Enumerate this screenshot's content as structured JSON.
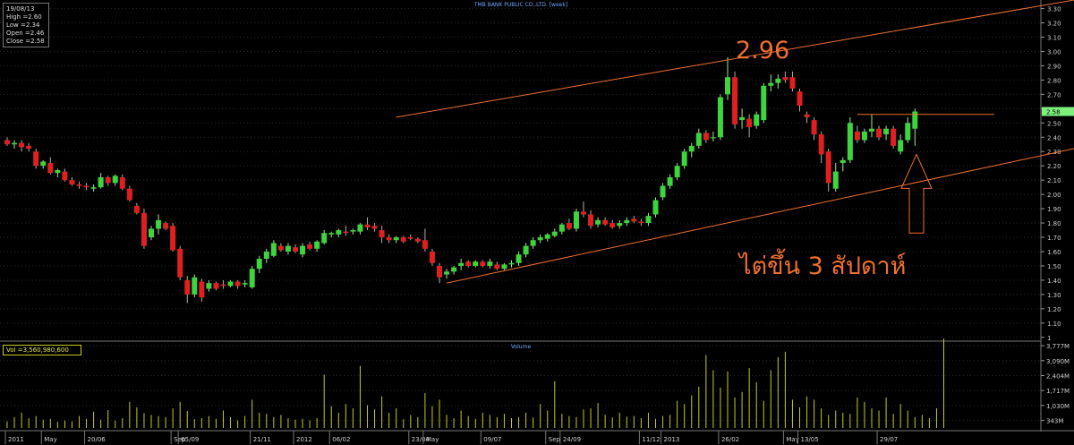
{
  "info": {
    "date": "19/08/13",
    "high": "High  =2.60",
    "low": "Low   =2.34",
    "open": "Open  =2.46",
    "close": "Close =2.58"
  },
  "volume_box": "Vol   =3,560,980,600",
  "colors": {
    "up": "#3dd43d",
    "down": "#e02020",
    "trend": "#f07030",
    "volume": "#c8c820",
    "grid": "#2a2a2a",
    "price_tag": "#7ef07e"
  },
  "chart_data": [
    {
      "type": "candlestick",
      "title": "TMB BANK PUBLIC CO.,LTD. [week]",
      "ylim": [
        0.98,
        3.36
      ],
      "y_ticks": [
        "3.30",
        "3.20",
        "3.10",
        "3.00",
        "2.90",
        "2.80",
        "2.70",
        "2.60",
        "2.50",
        "2.40",
        "2.30",
        "2.20",
        "2.10",
        "2.00",
        "1.90",
        "1.80",
        "1.70",
        "1.60",
        "1.50",
        "1.40",
        "1.30",
        "1.20",
        "1.10",
        "1"
      ],
      "last_price_tag": "2.58",
      "annotations": [
        "2.96",
        "ไต่ขึ้น 3 สัปดาห์"
      ],
      "candles": [
        {
          "o": 2.38,
          "h": 2.4,
          "l": 2.34,
          "c": 2.35
        },
        {
          "o": 2.35,
          "h": 2.38,
          "l": 2.32,
          "c": 2.36
        },
        {
          "o": 2.36,
          "h": 2.38,
          "l": 2.3,
          "c": 2.33
        },
        {
          "o": 2.34,
          "h": 2.36,
          "l": 2.3,
          "c": 2.32
        },
        {
          "o": 2.3,
          "h": 2.32,
          "l": 2.18,
          "c": 2.2
        },
        {
          "o": 2.2,
          "h": 2.24,
          "l": 2.18,
          "c": 2.23
        },
        {
          "o": 2.22,
          "h": 2.26,
          "l": 2.14,
          "c": 2.15
        },
        {
          "o": 2.15,
          "h": 2.18,
          "l": 2.12,
          "c": 2.17
        },
        {
          "o": 2.16,
          "h": 2.18,
          "l": 2.09,
          "c": 2.1
        },
        {
          "o": 2.1,
          "h": 2.12,
          "l": 2.06,
          "c": 2.07
        },
        {
          "o": 2.07,
          "h": 2.09,
          "l": 2.04,
          "c": 2.06
        },
        {
          "o": 2.06,
          "h": 2.08,
          "l": 2.03,
          "c": 2.05
        },
        {
          "o": 2.04,
          "h": 2.07,
          "l": 2.02,
          "c": 2.05
        },
        {
          "o": 2.05,
          "h": 2.15,
          "l": 2.04,
          "c": 2.12
        },
        {
          "o": 2.12,
          "h": 2.13,
          "l": 2.06,
          "c": 2.08
        },
        {
          "o": 2.08,
          "h": 2.14,
          "l": 2.06,
          "c": 2.13
        },
        {
          "o": 2.12,
          "h": 2.14,
          "l": 2.03,
          "c": 2.04
        },
        {
          "o": 2.04,
          "h": 2.06,
          "l": 1.95,
          "c": 1.96
        },
        {
          "o": 1.92,
          "h": 1.94,
          "l": 1.86,
          "c": 1.87
        },
        {
          "o": 1.87,
          "h": 1.9,
          "l": 1.62,
          "c": 1.64
        },
        {
          "o": 1.7,
          "h": 1.78,
          "l": 1.68,
          "c": 1.76
        },
        {
          "o": 1.76,
          "h": 1.86,
          "l": 1.72,
          "c": 1.82
        },
        {
          "o": 1.8,
          "h": 1.81,
          "l": 1.75,
          "c": 1.76
        },
        {
          "o": 1.78,
          "h": 1.8,
          "l": 1.6,
          "c": 1.61
        },
        {
          "o": 1.62,
          "h": 1.64,
          "l": 1.4,
          "c": 1.42
        },
        {
          "o": 1.4,
          "h": 1.43,
          "l": 1.24,
          "c": 1.3
        },
        {
          "o": 1.3,
          "h": 1.44,
          "l": 1.28,
          "c": 1.42
        },
        {
          "o": 1.39,
          "h": 1.41,
          "l": 1.25,
          "c": 1.28
        },
        {
          "o": 1.34,
          "h": 1.4,
          "l": 1.32,
          "c": 1.38
        },
        {
          "o": 1.38,
          "h": 1.39,
          "l": 1.33,
          "c": 1.34
        },
        {
          "o": 1.37,
          "h": 1.4,
          "l": 1.34,
          "c": 1.36
        },
        {
          "o": 1.36,
          "h": 1.4,
          "l": 1.35,
          "c": 1.39
        },
        {
          "o": 1.39,
          "h": 1.4,
          "l": 1.34,
          "c": 1.36
        },
        {
          "o": 1.37,
          "h": 1.4,
          "l": 1.35,
          "c": 1.38
        },
        {
          "o": 1.35,
          "h": 1.5,
          "l": 1.34,
          "c": 1.48
        },
        {
          "o": 1.48,
          "h": 1.57,
          "l": 1.45,
          "c": 1.55
        },
        {
          "o": 1.55,
          "h": 1.62,
          "l": 1.52,
          "c": 1.6
        },
        {
          "o": 1.57,
          "h": 1.68,
          "l": 1.56,
          "c": 1.66
        },
        {
          "o": 1.64,
          "h": 1.66,
          "l": 1.6,
          "c": 1.61
        },
        {
          "o": 1.6,
          "h": 1.66,
          "l": 1.58,
          "c": 1.64
        },
        {
          "o": 1.63,
          "h": 1.65,
          "l": 1.59,
          "c": 1.6
        },
        {
          "o": 1.58,
          "h": 1.66,
          "l": 1.56,
          "c": 1.64
        },
        {
          "o": 1.65,
          "h": 1.67,
          "l": 1.61,
          "c": 1.62
        },
        {
          "o": 1.62,
          "h": 1.68,
          "l": 1.6,
          "c": 1.67
        },
        {
          "o": 1.66,
          "h": 1.75,
          "l": 1.65,
          "c": 1.73
        },
        {
          "o": 1.72,
          "h": 1.74,
          "l": 1.7,
          "c": 1.73
        },
        {
          "o": 1.72,
          "h": 1.76,
          "l": 1.7,
          "c": 1.75
        },
        {
          "o": 1.74,
          "h": 1.78,
          "l": 1.71,
          "c": 1.73
        },
        {
          "o": 1.74,
          "h": 1.76,
          "l": 1.72,
          "c": 1.75
        },
        {
          "o": 1.74,
          "h": 1.8,
          "l": 1.72,
          "c": 1.79
        },
        {
          "o": 1.79,
          "h": 1.84,
          "l": 1.75,
          "c": 1.77
        },
        {
          "o": 1.78,
          "h": 1.8,
          "l": 1.74,
          "c": 1.76
        },
        {
          "o": 1.75,
          "h": 1.78,
          "l": 1.66,
          "c": 1.7
        },
        {
          "o": 1.7,
          "h": 1.72,
          "l": 1.66,
          "c": 1.68
        },
        {
          "o": 1.68,
          "h": 1.71,
          "l": 1.66,
          "c": 1.7
        },
        {
          "o": 1.7,
          "h": 1.71,
          "l": 1.66,
          "c": 1.67
        },
        {
          "o": 1.7,
          "h": 1.72,
          "l": 1.68,
          "c": 1.69
        },
        {
          "o": 1.69,
          "h": 1.7,
          "l": 1.66,
          "c": 1.67
        },
        {
          "o": 1.68,
          "h": 1.76,
          "l": 1.6,
          "c": 1.62
        },
        {
          "o": 1.6,
          "h": 1.62,
          "l": 1.5,
          "c": 1.52
        },
        {
          "o": 1.5,
          "h": 1.52,
          "l": 1.38,
          "c": 1.42
        },
        {
          "o": 1.44,
          "h": 1.48,
          "l": 1.41,
          "c": 1.46
        },
        {
          "o": 1.46,
          "h": 1.5,
          "l": 1.44,
          "c": 1.49
        },
        {
          "o": 1.5,
          "h": 1.55,
          "l": 1.47,
          "c": 1.52
        },
        {
          "o": 1.53,
          "h": 1.54,
          "l": 1.49,
          "c": 1.5
        },
        {
          "o": 1.5,
          "h": 1.54,
          "l": 1.49,
          "c": 1.53
        },
        {
          "o": 1.53,
          "h": 1.54,
          "l": 1.49,
          "c": 1.5
        },
        {
          "o": 1.5,
          "h": 1.55,
          "l": 1.48,
          "c": 1.53
        },
        {
          "o": 1.51,
          "h": 1.53,
          "l": 1.47,
          "c": 1.48
        },
        {
          "o": 1.48,
          "h": 1.52,
          "l": 1.47,
          "c": 1.51
        },
        {
          "o": 1.51,
          "h": 1.54,
          "l": 1.49,
          "c": 1.52
        },
        {
          "o": 1.52,
          "h": 1.6,
          "l": 1.5,
          "c": 1.58
        },
        {
          "o": 1.58,
          "h": 1.66,
          "l": 1.56,
          "c": 1.64
        },
        {
          "o": 1.64,
          "h": 1.7,
          "l": 1.62,
          "c": 1.68
        },
        {
          "o": 1.68,
          "h": 1.72,
          "l": 1.66,
          "c": 1.7
        },
        {
          "o": 1.69,
          "h": 1.73,
          "l": 1.67,
          "c": 1.72
        },
        {
          "o": 1.71,
          "h": 1.76,
          "l": 1.7,
          "c": 1.74
        },
        {
          "o": 1.74,
          "h": 1.8,
          "l": 1.72,
          "c": 1.79
        },
        {
          "o": 1.8,
          "h": 1.83,
          "l": 1.75,
          "c": 1.76
        },
        {
          "o": 1.76,
          "h": 1.9,
          "l": 1.74,
          "c": 1.88
        },
        {
          "o": 1.88,
          "h": 1.95,
          "l": 1.84,
          "c": 1.86
        },
        {
          "o": 1.86,
          "h": 1.89,
          "l": 1.76,
          "c": 1.78
        },
        {
          "o": 1.79,
          "h": 1.84,
          "l": 1.77,
          "c": 1.82
        },
        {
          "o": 1.82,
          "h": 1.84,
          "l": 1.78,
          "c": 1.79
        },
        {
          "o": 1.8,
          "h": 1.82,
          "l": 1.76,
          "c": 1.77
        },
        {
          "o": 1.78,
          "h": 1.82,
          "l": 1.76,
          "c": 1.8
        },
        {
          "o": 1.8,
          "h": 1.84,
          "l": 1.78,
          "c": 1.82
        },
        {
          "o": 1.83,
          "h": 1.85,
          "l": 1.8,
          "c": 1.81
        },
        {
          "o": 1.81,
          "h": 1.83,
          "l": 1.78,
          "c": 1.8
        },
        {
          "o": 1.8,
          "h": 1.87,
          "l": 1.78,
          "c": 1.85
        },
        {
          "o": 1.86,
          "h": 1.98,
          "l": 1.84,
          "c": 1.96
        },
        {
          "o": 1.98,
          "h": 2.08,
          "l": 1.96,
          "c": 2.06
        },
        {
          "o": 2.06,
          "h": 2.14,
          "l": 2.04,
          "c": 2.12
        },
        {
          "o": 2.12,
          "h": 2.22,
          "l": 2.1,
          "c": 2.2
        },
        {
          "o": 2.2,
          "h": 2.32,
          "l": 2.18,
          "c": 2.3
        },
        {
          "o": 2.3,
          "h": 2.36,
          "l": 2.26,
          "c": 2.34
        },
        {
          "o": 2.34,
          "h": 2.46,
          "l": 2.32,
          "c": 2.43
        },
        {
          "o": 2.43,
          "h": 2.45,
          "l": 2.36,
          "c": 2.38
        },
        {
          "o": 2.4,
          "h": 2.44,
          "l": 2.37,
          "c": 2.4
        },
        {
          "o": 2.4,
          "h": 2.7,
          "l": 2.38,
          "c": 2.68
        },
        {
          "o": 2.7,
          "h": 2.96,
          "l": 2.66,
          "c": 2.82
        },
        {
          "o": 2.82,
          "h": 2.86,
          "l": 2.46,
          "c": 2.49
        },
        {
          "o": 2.52,
          "h": 2.6,
          "l": 2.46,
          "c": 2.54
        },
        {
          "o": 2.53,
          "h": 2.56,
          "l": 2.4,
          "c": 2.47
        },
        {
          "o": 2.48,
          "h": 2.58,
          "l": 2.46,
          "c": 2.56
        },
        {
          "o": 2.52,
          "h": 2.78,
          "l": 2.5,
          "c": 2.76
        },
        {
          "o": 2.76,
          "h": 2.84,
          "l": 2.72,
          "c": 2.78
        },
        {
          "o": 2.78,
          "h": 2.84,
          "l": 2.74,
          "c": 2.81
        },
        {
          "o": 2.82,
          "h": 2.86,
          "l": 2.78,
          "c": 2.8
        },
        {
          "o": 2.82,
          "h": 2.86,
          "l": 2.72,
          "c": 2.74
        },
        {
          "o": 2.72,
          "h": 2.74,
          "l": 2.58,
          "c": 2.62
        },
        {
          "o": 2.56,
          "h": 2.58,
          "l": 2.5,
          "c": 2.54
        },
        {
          "o": 2.52,
          "h": 2.54,
          "l": 2.38,
          "c": 2.42
        },
        {
          "o": 2.42,
          "h": 2.44,
          "l": 2.22,
          "c": 2.28
        },
        {
          "o": 2.3,
          "h": 2.32,
          "l": 2.02,
          "c": 2.08
        },
        {
          "o": 2.04,
          "h": 2.22,
          "l": 2.02,
          "c": 2.16
        },
        {
          "o": 2.22,
          "h": 2.26,
          "l": 2.16,
          "c": 2.24
        },
        {
          "o": 2.24,
          "h": 2.54,
          "l": 2.22,
          "c": 2.5
        },
        {
          "o": 2.44,
          "h": 2.48,
          "l": 2.36,
          "c": 2.38
        },
        {
          "o": 2.38,
          "h": 2.46,
          "l": 2.36,
          "c": 2.44
        },
        {
          "o": 2.44,
          "h": 2.56,
          "l": 2.4,
          "c": 2.46
        },
        {
          "o": 2.46,
          "h": 2.48,
          "l": 2.38,
          "c": 2.4
        },
        {
          "o": 2.42,
          "h": 2.48,
          "l": 2.38,
          "c": 2.46
        },
        {
          "o": 2.46,
          "h": 2.48,
          "l": 2.32,
          "c": 2.34
        },
        {
          "o": 2.3,
          "h": 2.42,
          "l": 2.28,
          "c": 2.38
        },
        {
          "o": 2.38,
          "h": 2.54,
          "l": 2.36,
          "c": 2.5
        },
        {
          "o": 2.46,
          "h": 2.6,
          "l": 2.34,
          "c": 2.58
        }
      ]
    },
    {
      "type": "bar",
      "title": "Volume",
      "ylim": [
        0,
        3944000000
      ],
      "y_ticks": [
        "3,777M",
        "3,090M",
        "2,404M",
        "1,717M",
        "1,030M",
        "343M"
      ],
      "values": [
        300000000,
        500000000,
        700000000,
        450000000,
        550000000,
        380000000,
        420000000,
        280000000,
        350000000,
        300000000,
        550000000,
        420000000,
        750000000,
        380000000,
        820000000,
        350000000,
        450000000,
        1200000000,
        950000000,
        680000000,
        600000000,
        550000000,
        500000000,
        900000000,
        1200000000,
        780000000,
        400000000,
        450000000,
        550000000,
        420000000,
        800000000,
        500000000,
        350000000,
        550000000,
        1300000000,
        700000000,
        650000000,
        500000000,
        600000000,
        450000000,
        380000000,
        420000000,
        350000000,
        450000000,
        2450000000,
        1000000000,
        700000000,
        1100000000,
        900000000,
        2850000000,
        1050000000,
        850000000,
        1450000000,
        700000000,
        900000000,
        400000000,
        600000000,
        500000000,
        1600000000,
        1000000000,
        1300000000,
        600000000,
        450000000,
        800000000,
        550000000,
        420000000,
        700000000,
        600000000,
        500000000,
        650000000,
        450000000,
        500000000,
        700000000,
        480000000,
        1100000000,
        800000000,
        2150000000,
        650000000,
        550000000,
        500000000,
        850000000,
        900000000,
        1150000000,
        600000000,
        480000000,
        700000000,
        520000000,
        550000000,
        450000000,
        700000000,
        420000000,
        550000000,
        600000000,
        1250000000,
        1100000000,
        1500000000,
        1900000000,
        3350000000,
        2650000000,
        1850000000,
        2600000000,
        1400000000,
        1650000000,
        2750000000,
        2100000000,
        1250000000,
        2650000000,
        3250000000,
        3500000000,
        1300000000,
        950000000,
        1450000000,
        1300000000,
        900000000,
        600000000,
        800000000,
        700000000,
        650000000,
        1400000000,
        1200000000,
        900000000,
        800000000,
        1400000000,
        650000000,
        1100000000,
        800000000,
        500000000,
        600000000,
        450000000,
        900000000,
        4100000000
      ]
    }
  ],
  "x_labels": [
    {
      "text": "2011",
      "i": 0
    },
    {
      "text": "May",
      "i": 5
    },
    {
      "text": "20/06",
      "i": 11
    },
    {
      "text": "Sep",
      "i": 23
    },
    {
      "text": "05/09",
      "i": 24
    },
    {
      "text": "21/11",
      "i": 34
    },
    {
      "text": "2012",
      "i": 40
    },
    {
      "text": "06/02",
      "i": 45
    },
    {
      "text": "23/04",
      "i": 56
    },
    {
      "text": "May",
      "i": 58
    },
    {
      "text": "09/07",
      "i": 66
    },
    {
      "text": "Sep",
      "i": 75
    },
    {
      "text": "24/09",
      "i": 77
    },
    {
      "text": "11/12",
      "i": 88
    },
    {
      "text": "2013",
      "i": 91
    },
    {
      "text": "26/02",
      "i": 99
    },
    {
      "text": "May",
      "i": 108
    },
    {
      "text": "13/05",
      "i": 110
    },
    {
      "text": "29/07",
      "i": 121
    }
  ]
}
